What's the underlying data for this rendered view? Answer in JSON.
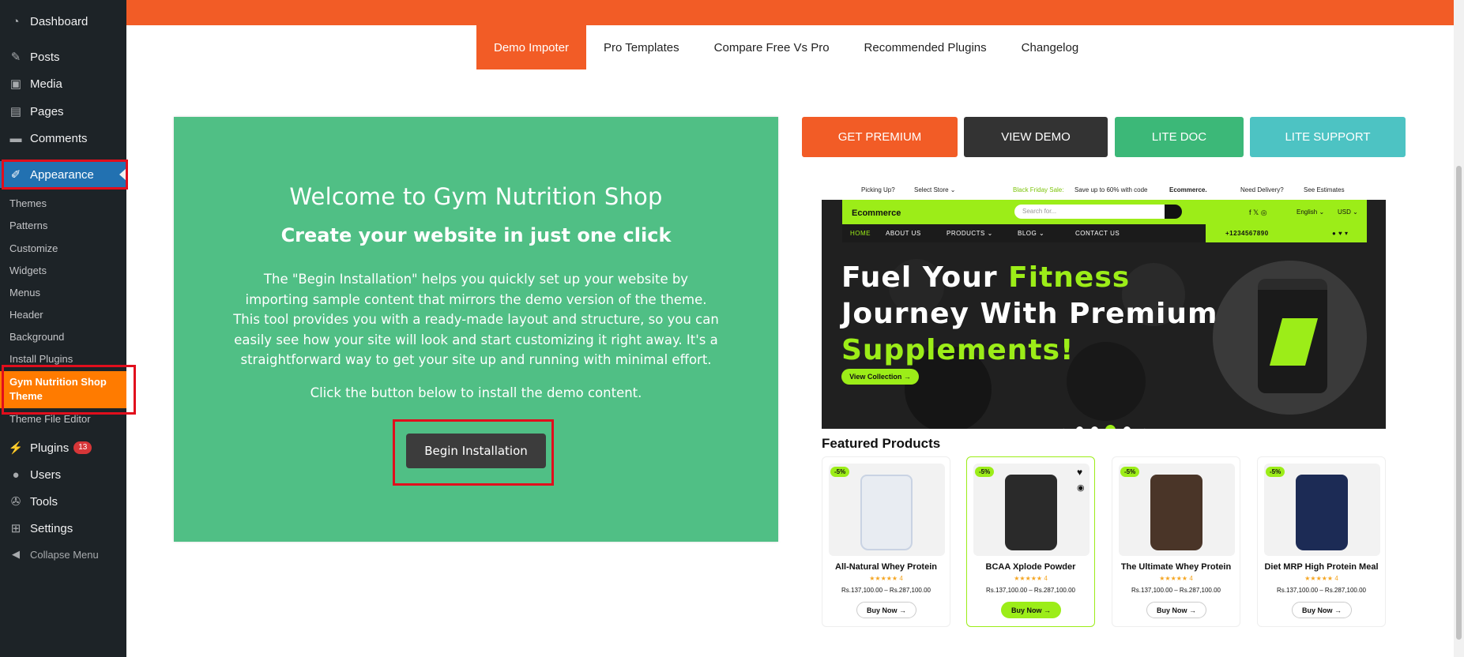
{
  "sidebar": {
    "items": [
      {
        "label": "Dashboard",
        "icon": "dashboard-icon"
      },
      {
        "label": "Posts",
        "icon": "pin-icon"
      },
      {
        "label": "Media",
        "icon": "media-icon"
      },
      {
        "label": "Pages",
        "icon": "pages-icon"
      },
      {
        "label": "Comments",
        "icon": "comment-icon"
      },
      {
        "label": "Appearance",
        "icon": "brush-icon"
      },
      {
        "label": "Plugins",
        "icon": "plug-icon",
        "badge": "13"
      },
      {
        "label": "Users",
        "icon": "user-icon"
      },
      {
        "label": "Tools",
        "icon": "wrench-icon"
      },
      {
        "label": "Settings",
        "icon": "settings-icon"
      },
      {
        "label": "Collapse Menu",
        "icon": "collapse-icon"
      }
    ],
    "submenu": [
      "Themes",
      "Patterns",
      "Customize",
      "Widgets",
      "Menus",
      "Header",
      "Background",
      "Install Plugins",
      "Gym Nutrition Shop Theme",
      "Theme File Editor"
    ]
  },
  "tabs": [
    "Demo Impoter",
    "Pro Templates",
    "Compare Free Vs Pro",
    "Recommended Plugins",
    "Changelog"
  ],
  "panel": {
    "welcome": "Welcome to Gym Nutrition Shop",
    "subhead": "Create your website in just one click",
    "description": "The \"Begin Installation\" helps you quickly set up your website by importing sample content that mirrors the demo version of the theme. This tool provides you with a ready-made layout and structure, so you can easily see how your site will look and start customizing it right away. It's a straightforward way to get your site up and running with minimal effort.",
    "click_line": "Click the button below to install the demo content.",
    "button": "Begin Installation"
  },
  "actions": [
    {
      "label": "GET PREMIUM",
      "color": "#f25c26"
    },
    {
      "label": "VIEW DEMO",
      "color": "#333333"
    },
    {
      "label": "LITE DOC",
      "color": "#3cb878"
    },
    {
      "label": "LITE SUPPORT",
      "color": "#4dc3c3"
    }
  ],
  "preview": {
    "utility": {
      "picking": "Picking Up?",
      "store": "Select Store ⌄",
      "promo_hl": "Black Friday Sale:",
      "promo": "Save up to 60% with code",
      "promo_code": "Ecommerce.",
      "delivery": "Need Delivery?",
      "estimates": "See Estimates"
    },
    "brand": "Ecommerce",
    "search_placeholder": "Search for...",
    "lang": "English ⌄",
    "currency": "USD ⌄",
    "nav": [
      "HOME",
      "ABOUT US",
      "PRODUCTS ⌄",
      "BLOG ⌄",
      "CONTACT US"
    ],
    "phone": "+1234567890",
    "hero_line1_a": "Fuel Your ",
    "hero_line1_b": "Fitness",
    "hero_line2": "Journey With Premium",
    "hero_line3": "Supplements!",
    "hero_button": "View Collection  →",
    "featured_title": "Featured Products",
    "products": [
      {
        "name": "All-Natural Whey Protein",
        "price": "Rs.137,100.00 – Rs.287,100.00",
        "sale": "-5%",
        "rating": "★★★★★ 4",
        "color": "#e8ecf2"
      },
      {
        "name": "BCAA Xplode Powder",
        "price": "Rs.137,100.00 – Rs.287,100.00",
        "sale": "-5%",
        "rating": "★★★★★ 4",
        "color": "#2a2a2a"
      },
      {
        "name": "The Ultimate Whey Protein",
        "price": "Rs.137,100.00 – Rs.287,100.00",
        "sale": "-5%",
        "rating": "★★★★★ 4",
        "color": "#4a3528"
      },
      {
        "name": "Diet MRP High Protein Meal",
        "price": "Rs.137,100.00 – Rs.287,100.00",
        "sale": "-5%",
        "rating": "★★★★★ 4",
        "color": "#1c2b55"
      }
    ],
    "buy_label": "Buy Now  →"
  }
}
